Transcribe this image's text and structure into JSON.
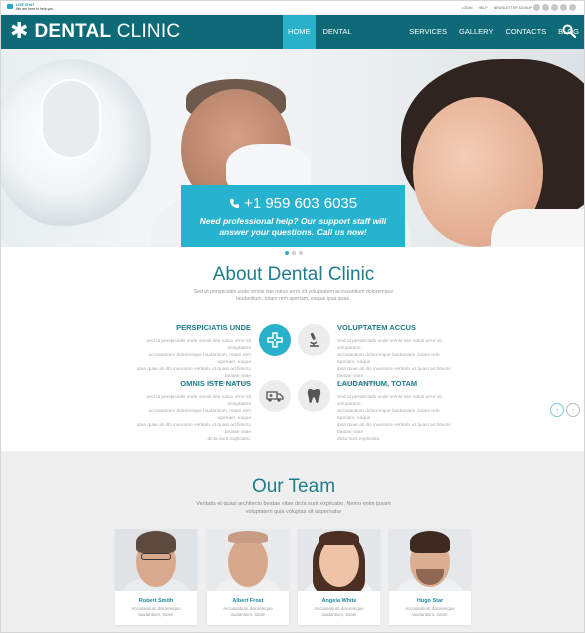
{
  "topbar": {
    "chat_title": "LIVE CHAT",
    "chat_text": "We are here to help you",
    "links": [
      "LOGIN",
      "HELP",
      "NEWSLETTER SIGNUP"
    ]
  },
  "header": {
    "logo_bold": "DENTAL",
    "logo_light": "CLINIC",
    "nav": [
      "HOME",
      "DENTAL TREATMENTS",
      "SERVICES",
      "GALLERY",
      "CONTACTS",
      "BLOG"
    ],
    "active_nav": "HOME",
    "accent": "#29b1cc",
    "header_bg": "#0f6a78"
  },
  "hero": {
    "phone": "+1 959 603 6035",
    "message_line1": "Need professional help? Our support staff will",
    "message_line2": "answer your questions. Call us now!",
    "slide_index": 1,
    "slide_count": 3
  },
  "about": {
    "title": "About Dental Clinic",
    "subtitle_line1": "Sed ut perspiciatis unde omnis iste natus error sit voluptatem accusantium doloremque",
    "subtitle_line2": "laudantium, totam rem aperiam, eaque ipsa quae.",
    "features": [
      {
        "title": "PERSPICIATIS UNDE",
        "icon": "hospital-icon",
        "text": [
          "Sed ut perspiciatis unde omnis iste natus error sit voluptatem",
          "accusantium doloremque laudantium, totam rem aperiam, eaque",
          "ipsa quae ab illo inventore veritatis et quasi architecto beatae vitae",
          "dicta sunt explicabo."
        ]
      },
      {
        "title": "VOLUPTATEM ACCUS",
        "icon": "microscope-icon",
        "text": [
          "Sed ut perspiciatis unde omnis iste natus error sit voluptatem",
          "accusantium doloremque laudantium, totam rem aperiam, eaque",
          "ipsa quae ab illo inventore veritatis et quasi architecto beatae vitae",
          "dicta sunt explicabo."
        ]
      },
      {
        "title": "OMNIS ISTE NATUS",
        "icon": "ambulance-icon",
        "text": [
          "Sed ut perspiciatis unde omnis iste natus error sit voluptatem",
          "accusantium doloremque laudantium, totam rem aperiam, eaque",
          "ipsa quae ab illo inventore veritatis et quasi architecto beatae vitae",
          "dicta sunt explicabo."
        ]
      },
      {
        "title": "LAUDANTIUM, TOTAM",
        "icon": "tooth-icon",
        "text": [
          "Sed ut perspiciatis unde omnis iste natus error sit voluptatem",
          "accusantium doloremque laudantium, totam rem aperiam, eaque",
          "ipsa quae ab illo inventore veritatis et quasi architecto beatae vitae",
          "dicta sunt explicabo."
        ]
      }
    ]
  },
  "team": {
    "title": "Our Team",
    "subtitle_line1": "Veritatis et quasi architecto beatae vitae dicta sunt explicabo. Nemo enim ipsam",
    "subtitle_line2": "voluptatem quia voluptas sit aspernatur",
    "members": [
      {
        "name": "Robert Smith",
        "desc1": "Accusantium doloremque",
        "desc2": "laudantium, totam"
      },
      {
        "name": "Albert Frost",
        "desc1": "Accusantium doloremque",
        "desc2": "laudantium, totam"
      },
      {
        "name": "Angela White",
        "desc1": "Accusantium doloremque",
        "desc2": "laudantium, totam"
      },
      {
        "name": "Hugo Star",
        "desc1": "Accusantium doloremque",
        "desc2": "laudantium, totam"
      }
    ]
  }
}
